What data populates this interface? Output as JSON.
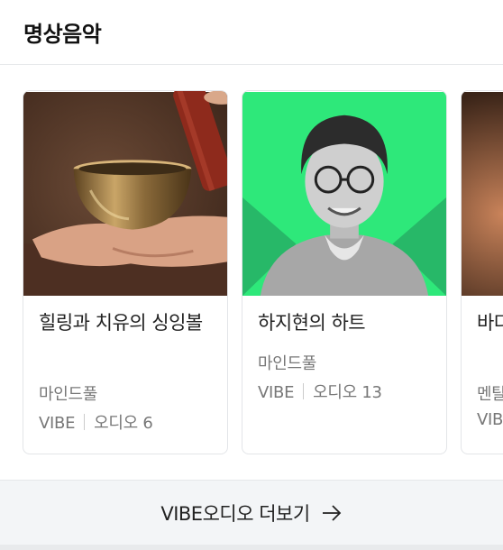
{
  "header": {
    "title": "명상음악"
  },
  "cards": [
    {
      "title": "힐링과 치유의 싱잉볼",
      "author": "마인드풀",
      "source": "VIBE",
      "count": "오디오 6"
    },
    {
      "title": "하지현의 하트",
      "author": "마인드풀",
      "source": "VIBE",
      "count": "오디오 13"
    },
    {
      "title": "바다인 …",
      "author": "멘탈",
      "source": "VIBE",
      "count": ""
    }
  ],
  "footer": {
    "more_label": "VIBE오디오 더보기"
  }
}
